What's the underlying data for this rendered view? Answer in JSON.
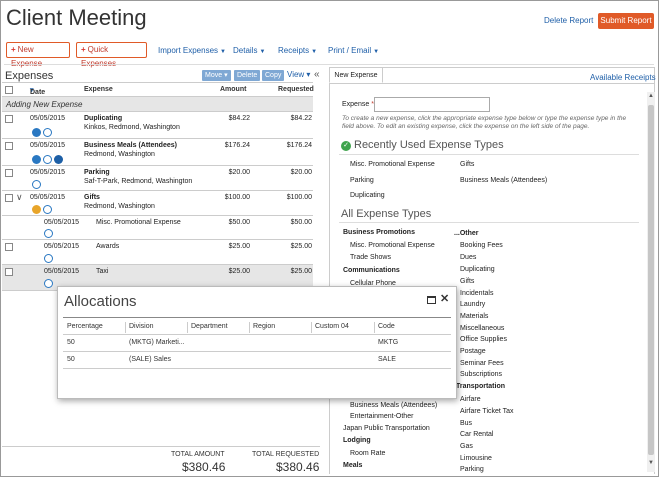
{
  "header": {
    "title": "Client Meeting",
    "delete_report": "Delete Report",
    "submit_report": "Submit Report"
  },
  "toolbar": {
    "new_expense": "New Expense",
    "quick_expenses": "Quick Expenses",
    "import_expenses": "Import Expenses",
    "details": "Details",
    "receipts": "Receipts",
    "print_email": "Print / Email"
  },
  "left": {
    "title": "Expenses",
    "move": "Move",
    "delete": "Delete",
    "copy": "Copy",
    "view": "View",
    "collapse": "«",
    "columns": {
      "date": "Date",
      "expense": "Expense",
      "amount": "Amount",
      "requested": "Requested"
    },
    "adding_row": "Adding New Expense",
    "rows": [
      {
        "date": "05/05/2015",
        "type": "Duplicating",
        "vendor": "Kinkos, Redmond, Washington",
        "amount": "$84.22",
        "requested": "$84.22"
      },
      {
        "date": "05/05/2015",
        "type": "Business Meals (Attendees)",
        "vendor": "Redmond, Washington",
        "amount": "$176.24",
        "requested": "$176.24"
      },
      {
        "date": "05/05/2015",
        "type": "Parking",
        "vendor": "Saf-T-Park, Redmond, Washington",
        "amount": "$20.00",
        "requested": "$20.00"
      },
      {
        "date": "05/05/2015",
        "type": "Gifts",
        "vendor": "Redmond, Washington",
        "amount": "$100.00",
        "requested": "$100.00"
      },
      {
        "date": "05/05/2015",
        "type": "Misc. Promotional Expense",
        "vendor": "",
        "amount": "$50.00",
        "requested": "$50.00"
      },
      {
        "date": "05/05/2015",
        "type": "Awards",
        "vendor": "",
        "amount": "$25.00",
        "requested": "$25.00"
      },
      {
        "date": "05/05/2015",
        "type": "Taxi",
        "vendor": "",
        "amount": "$25.00",
        "requested": "$25.00"
      }
    ],
    "totals": {
      "amount_label": "TOTAL AMOUNT",
      "amount_value": "$380.46",
      "requested_label": "TOTAL REQUESTED",
      "requested_value": "$380.46"
    }
  },
  "right": {
    "tab_new_expense": "New Expense",
    "available_receipts": "Available Receipts",
    "expense_label": "Expense",
    "required_mark": "*",
    "hint": "To create a new expense, click the appropriate expense type below or type the expense type in the field above. To edit an existing expense, click the expense on the left side of the page.",
    "recent_title": "Recently Used Expense Types",
    "recent_left": [
      "Misc. Promotional Expense",
      "Parking",
      "Duplicating"
    ],
    "recent_right": [
      "Gifts",
      "Business Meals (Attendees)"
    ],
    "all_title": "All Expense Types",
    "col1": [
      {
        "text": "Business Promotions",
        "bold": true
      },
      {
        "text": "Misc. Promotional Expense",
        "bold": false
      },
      {
        "text": "Trade Shows",
        "bold": false
      },
      {
        "text": "Communications",
        "bold": true
      },
      {
        "text": "Cellular Phone",
        "bold": false
      }
    ],
    "col1_lower": [
      {
        "text": "Business Meals (Attendees)",
        "bold": false
      },
      {
        "text": "Entertainment-Other",
        "bold": false
      },
      {
        "text": "Japan Public Transportation",
        "bold": false
      },
      {
        "text": "Lodging",
        "bold": true
      },
      {
        "text": "Room Rate",
        "bold": false
      },
      {
        "text": "Meals",
        "bold": true
      }
    ],
    "col2": [
      {
        "text": "...Other",
        "bold": true
      },
      {
        "text": "Booking Fees",
        "bold": false
      },
      {
        "text": "Dues",
        "bold": false
      },
      {
        "text": "Duplicating",
        "bold": false
      },
      {
        "text": "Gifts",
        "bold": false
      },
      {
        "text": "Incidentals",
        "bold": false
      },
      {
        "text": "Laundry",
        "bold": false
      },
      {
        "text": "Materials",
        "bold": false
      },
      {
        "text": "Miscellaneous",
        "bold": false
      },
      {
        "text": "Office Supplies",
        "bold": false
      },
      {
        "text": "Postage",
        "bold": false
      },
      {
        "text": "Seminar Fees",
        "bold": false
      },
      {
        "text": "Subscriptions",
        "bold": false
      },
      {
        "text": "Transportation",
        "bold": true
      },
      {
        "text": "Airfare",
        "bold": false
      },
      {
        "text": "Airfare Ticket Tax",
        "bold": false
      },
      {
        "text": "Bus",
        "bold": false
      },
      {
        "text": "Car Rental",
        "bold": false
      },
      {
        "text": "Gas",
        "bold": false
      },
      {
        "text": "Limousine",
        "bold": false
      },
      {
        "text": "Parking",
        "bold": false
      }
    ]
  },
  "dialog": {
    "title": "Allocations",
    "close": "✕",
    "columns": [
      "Percentage",
      "Division",
      "Department",
      "Region",
      "Custom 04",
      "Code"
    ],
    "rows": [
      {
        "percentage": "50",
        "division": "(MKTG) Marketi...",
        "code": "MKTG"
      },
      {
        "percentage": "50",
        "division": "(SALE) Sales",
        "code": "SALE"
      }
    ]
  }
}
